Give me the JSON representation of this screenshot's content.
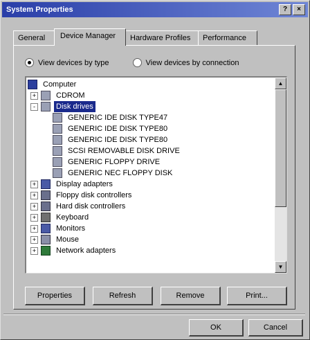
{
  "window": {
    "title": "System Properties",
    "buttons": [
      "?",
      "×"
    ]
  },
  "tabs": [
    {
      "label": "General",
      "active": false
    },
    {
      "label": "Device Manager",
      "active": true
    },
    {
      "label": "Hardware Profiles",
      "active": false
    },
    {
      "label": "Performance",
      "active": false
    }
  ],
  "view": {
    "by_type": "View devices by type",
    "by_connection": "View devices by connection",
    "selected": "by_type"
  },
  "tree": {
    "items": [
      {
        "label": "Computer",
        "icon": "computer-icon",
        "expander": "",
        "indent": 0
      },
      {
        "label": "CDROM",
        "icon": "cdrom-icon",
        "expander": "+",
        "indent": 1
      },
      {
        "label": "Disk drives",
        "icon": "disk-drives-icon",
        "expander": "-",
        "indent": 1,
        "selected": true
      },
      {
        "label": "GENERIC IDE DISK TYPE47",
        "icon": "drive-icon",
        "expander": "",
        "indent": 2
      },
      {
        "label": "GENERIC IDE DISK TYPE80",
        "icon": "drive-icon",
        "expander": "",
        "indent": 2
      },
      {
        "label": "GENERIC IDE DISK TYPE80",
        "icon": "drive-icon",
        "expander": "",
        "indent": 2
      },
      {
        "label": "SCSI REMOVABLE DISK DRIVE",
        "icon": "drive-icon",
        "expander": "",
        "indent": 2
      },
      {
        "label": "GENERIC FLOPPY DRIVE",
        "icon": "drive-icon",
        "expander": "",
        "indent": 2
      },
      {
        "label": "GENERIC NEC FLOPPY DISK",
        "icon": "drive-icon",
        "expander": "",
        "indent": 2
      },
      {
        "label": "Display adapters",
        "icon": "display-icon",
        "expander": "+",
        "indent": 1
      },
      {
        "label": "Floppy disk controllers",
        "icon": "controller-icon",
        "expander": "+",
        "indent": 1
      },
      {
        "label": "Hard disk controllers",
        "icon": "controller-icon",
        "expander": "+",
        "indent": 1
      },
      {
        "label": "Keyboard",
        "icon": "keyboard-icon",
        "expander": "+",
        "indent": 1
      },
      {
        "label": "Monitors",
        "icon": "monitor-icon",
        "expander": "+",
        "indent": 1
      },
      {
        "label": "Mouse",
        "icon": "mouse-icon",
        "expander": "+",
        "indent": 1
      },
      {
        "label": "Network adapters",
        "icon": "network-icon",
        "expander": "+",
        "indent": 1
      }
    ]
  },
  "actions": {
    "properties": "Properties",
    "refresh": "Refresh",
    "remove": "Remove",
    "print": "Print..."
  },
  "dialog": {
    "ok": "OK",
    "cancel": "Cancel"
  },
  "colors": {
    "title_start": "#2a3ea8",
    "title_end": "#6f86d6",
    "selection": "#1a2a8c",
    "face": "#c0c0c0"
  }
}
